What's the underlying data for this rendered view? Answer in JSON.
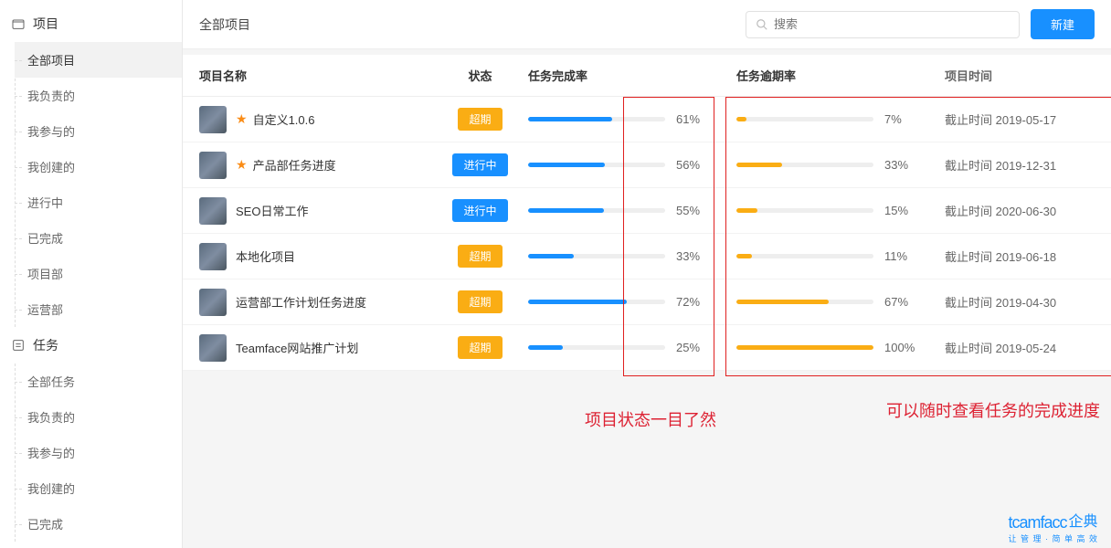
{
  "sidebar": {
    "sections": [
      {
        "title": "项目",
        "icon": "folder-icon",
        "items": [
          "全部项目",
          "我负责的",
          "我参与的",
          "我创建的",
          "进行中",
          "已完成",
          "项目部",
          "运营部"
        ],
        "activeIndex": 0
      },
      {
        "title": "任务",
        "icon": "checklist-icon",
        "items": [
          "全部任务",
          "我负责的",
          "我参与的",
          "我创建的",
          "已完成"
        ]
      }
    ]
  },
  "header": {
    "title": "全部项目",
    "search_placeholder": "搜索",
    "new_label": "新建"
  },
  "columns": {
    "name": "项目名称",
    "status": "状态",
    "completion": "任务完成率",
    "overdue": "任务逾期率",
    "time": "项目时间"
  },
  "status_labels": {
    "overdue": "超期",
    "in_progress": "进行中"
  },
  "time_prefix": "截止时间",
  "rows": [
    {
      "starred": true,
      "name": "自定义1.0.6",
      "status": "overdue",
      "completion": 61,
      "overdue": 7,
      "deadline": "2019-05-17"
    },
    {
      "starred": true,
      "name": "产品部任务进度",
      "status": "in_progress",
      "completion": 56,
      "overdue": 33,
      "deadline": "2019-12-31"
    },
    {
      "starred": false,
      "name": "SEO日常工作",
      "status": "in_progress",
      "completion": 55,
      "overdue": 15,
      "deadline": "2020-06-30"
    },
    {
      "starred": false,
      "name": "本地化项目",
      "status": "overdue",
      "completion": 33,
      "overdue": 11,
      "deadline": "2019-06-18"
    },
    {
      "starred": false,
      "name": "运营部工作计划任务进度",
      "status": "overdue",
      "completion": 72,
      "overdue": 67,
      "deadline": "2019-04-30"
    },
    {
      "starred": false,
      "name": "Teamface网站推广计划",
      "status": "overdue",
      "completion": 25,
      "overdue": 100,
      "deadline": "2019-05-24"
    }
  ],
  "annotations": {
    "status_note": "项目状态一目了然",
    "progress_note": "可以随时查看任务的完成进度"
  },
  "footer": {
    "brand": "tcamfacc",
    "cn": "企典",
    "sub": "让 管 理 · 简 单 高 效"
  }
}
